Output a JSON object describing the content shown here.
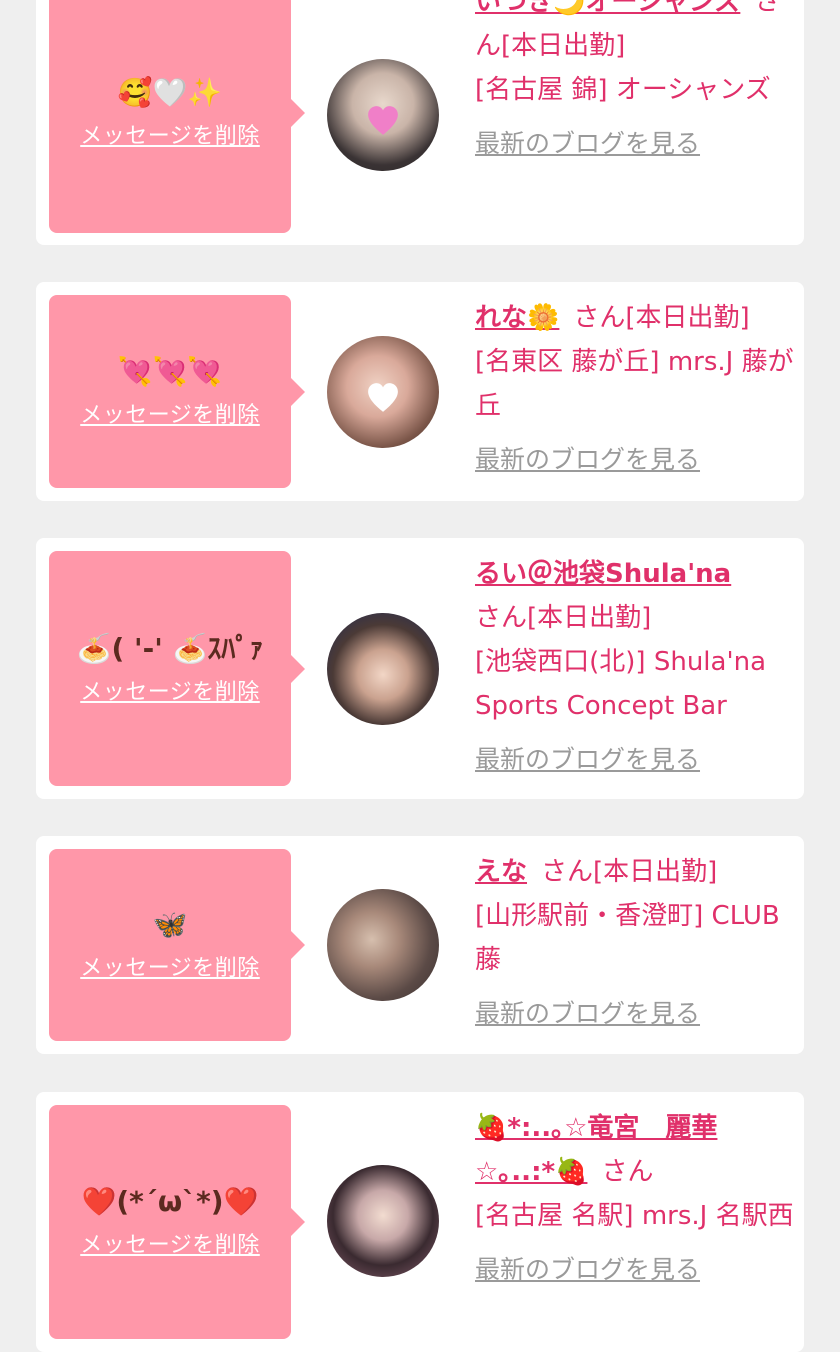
{
  "colors": {
    "accent": "#e0306a",
    "bubble": "#ff97a9",
    "background": "#efefef",
    "card": "#ffffff",
    "link_gray": "#9a9a9a"
  },
  "cards": [
    {
      "message": "🥰🤍✨",
      "delete_label": "メッセージを削除",
      "name": "いつき🌙オーシャンズ",
      "suffix": "さん[本日出勤]",
      "place": "[名古屋 錦] オーシャンズ",
      "blog_label": "最新のブログを見る",
      "avatar_icon": "woman-photo-icon"
    },
    {
      "message": "💘💘💘",
      "delete_label": "メッセージを削除",
      "name": "れな🌼",
      "suffix": "さん[本日出勤]",
      "place": "[名東区 藤が丘] mrs.J 藤が丘",
      "blog_label": "最新のブログを見る",
      "avatar_icon": "woman-photo-icon"
    },
    {
      "message": "🍝( '-' 🍝ｽﾊﾟｧ",
      "delete_label": "メッセージを削除",
      "name": "るい＠池袋Shula'na",
      "suffix": "さん[本日出勤]",
      "place": "[池袋西口(北)] Shula'na Sports Concept Bar",
      "blog_label": "最新のブログを見る",
      "avatar_icon": "woman-photo-icon"
    },
    {
      "message": "🦋",
      "delete_label": "メッセージを削除",
      "name": "えな",
      "suffix": "さん[本日出勤]",
      "place": "[山形駅前・香澄町] CLUB 藤",
      "blog_label": "最新のブログを見る",
      "avatar_icon": "woman-photo-icon"
    },
    {
      "message": "❤️(*´ω`*)❤️",
      "delete_label": "メッセージを削除",
      "name": "🍓*:..｡☆竜宮　麗華☆｡..:*🍓",
      "suffix": "さん",
      "place": "[名古屋 名駅] mrs.J 名駅西",
      "blog_label": "最新のブログを見る",
      "avatar_icon": "woman-photo-icon"
    }
  ]
}
